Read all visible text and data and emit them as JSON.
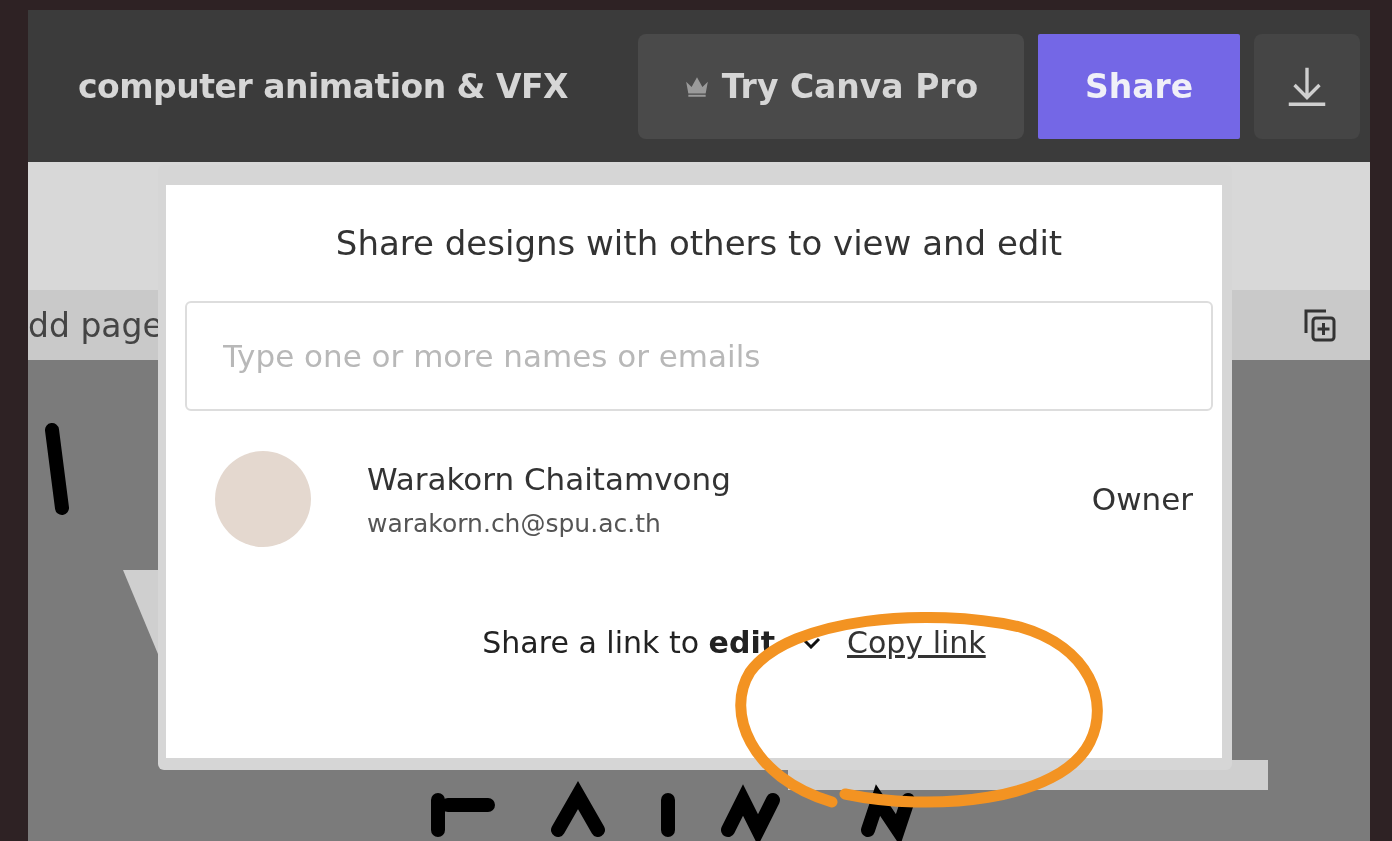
{
  "topbar": {
    "title": "computer animation & VFX",
    "buttons": [
      {
        "kind": "pro",
        "label": "Try Canva Pro"
      },
      {
        "kind": "primary",
        "label": "Share"
      },
      {
        "kind": "download"
      }
    ]
  },
  "page_strip": {
    "label": "dd page"
  },
  "share_dialog": {
    "heading": "Share designs with others to view and edit",
    "invite_field": {
      "placeholder": "Type one or more names or emails"
    },
    "members": [
      {
        "name": "Warakorn Chaitamvong",
        "email": "warakorn.ch@spu.ac.th",
        "role": "Owner"
      }
    ],
    "link": {
      "text": "Share a link to **edit**",
      "copy": "Copy link"
    }
  }
}
